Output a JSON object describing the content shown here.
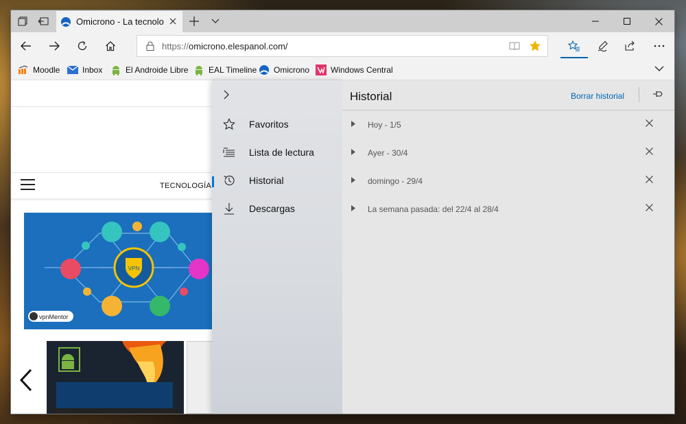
{
  "tab": {
    "title": "Omicrono - La tecnolog"
  },
  "address": {
    "protocol": "https://",
    "domain": "omicrono.elespanol.com/"
  },
  "favorites_bar": [
    {
      "label": "Moodle",
      "icon": "moodle-icon"
    },
    {
      "label": "Inbox",
      "icon": "inbox-icon"
    },
    {
      "label": "El Androide Libre",
      "icon": "android-icon"
    },
    {
      "label": "EAL Timeline",
      "icon": "android-icon"
    },
    {
      "label": "Omicrono",
      "icon": "omicrono-icon"
    },
    {
      "label": "Windows Central",
      "icon": "windows-central-icon"
    }
  ],
  "page": {
    "section": "TECNOLOGÍA",
    "hero_badge": "VPN",
    "hero_brand": "vpnMentor"
  },
  "hub": {
    "items": [
      {
        "label": "Favoritos",
        "icon": "star-icon"
      },
      {
        "label": "Lista de lectura",
        "icon": "reading-list-icon"
      },
      {
        "label": "Historial",
        "icon": "history-icon"
      },
      {
        "label": "Descargas",
        "icon": "download-icon"
      }
    ],
    "history": {
      "title": "Historial",
      "clear_label": "Borrar historial",
      "groups": [
        {
          "label": "Hoy - 1/5"
        },
        {
          "label": "Ayer - 30/4"
        },
        {
          "label": "domingo - 29/4"
        },
        {
          "label": "La semana pasada: del 22/4 al 28/4"
        }
      ]
    }
  },
  "colors": {
    "accent": "#0078d7",
    "link": "#0063b1",
    "star": "#f0b400"
  }
}
